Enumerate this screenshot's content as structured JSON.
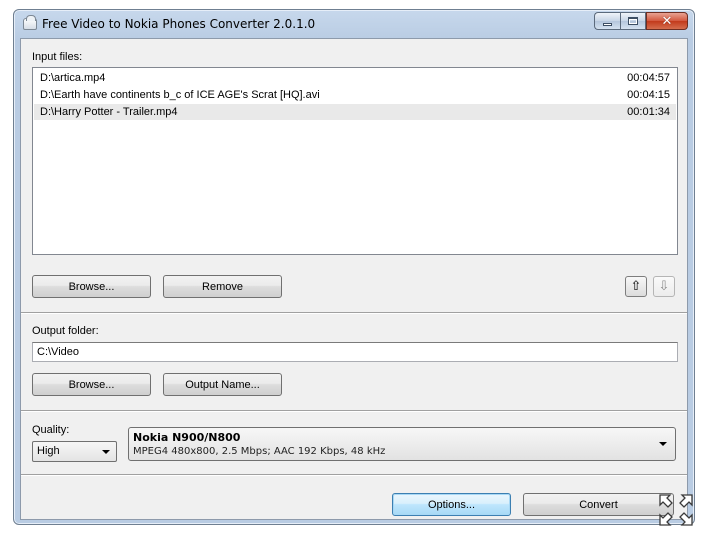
{
  "window": {
    "title": "Free Video to Nokia Phones Converter 2.0.1.0"
  },
  "input": {
    "label": "Input files:",
    "files": [
      {
        "name": "D:\\artica.mp4",
        "duration": "00:04:57"
      },
      {
        "name": "D:\\Earth have continents b_c of ICE AGE's Scrat [HQ].avi",
        "duration": "00:04:15"
      },
      {
        "name": "D:\\Harry Potter - Trailer.mp4",
        "duration": "00:01:34"
      }
    ],
    "browse_label": "Browse...",
    "remove_label": "Remove",
    "move_up_glyph": "⇧",
    "move_down_glyph": "⇩"
  },
  "output": {
    "label": "Output folder:",
    "folder": "C:\\Video",
    "browse_label": "Browse...",
    "output_name_label": "Output Name..."
  },
  "quality": {
    "label": "Quality:",
    "selected": "High"
  },
  "profile": {
    "name": "Nokia N900/N800",
    "description": "MPEG4 480x800, 2.5 Mbps; AAC 192 Kbps, 48 kHz"
  },
  "actions": {
    "options_label": "Options...",
    "convert_label": "Convert"
  },
  "colors": {
    "selected_row": "#e9e9e9",
    "close_button": "#c23a1c",
    "title_bar": "#b9cce3"
  }
}
